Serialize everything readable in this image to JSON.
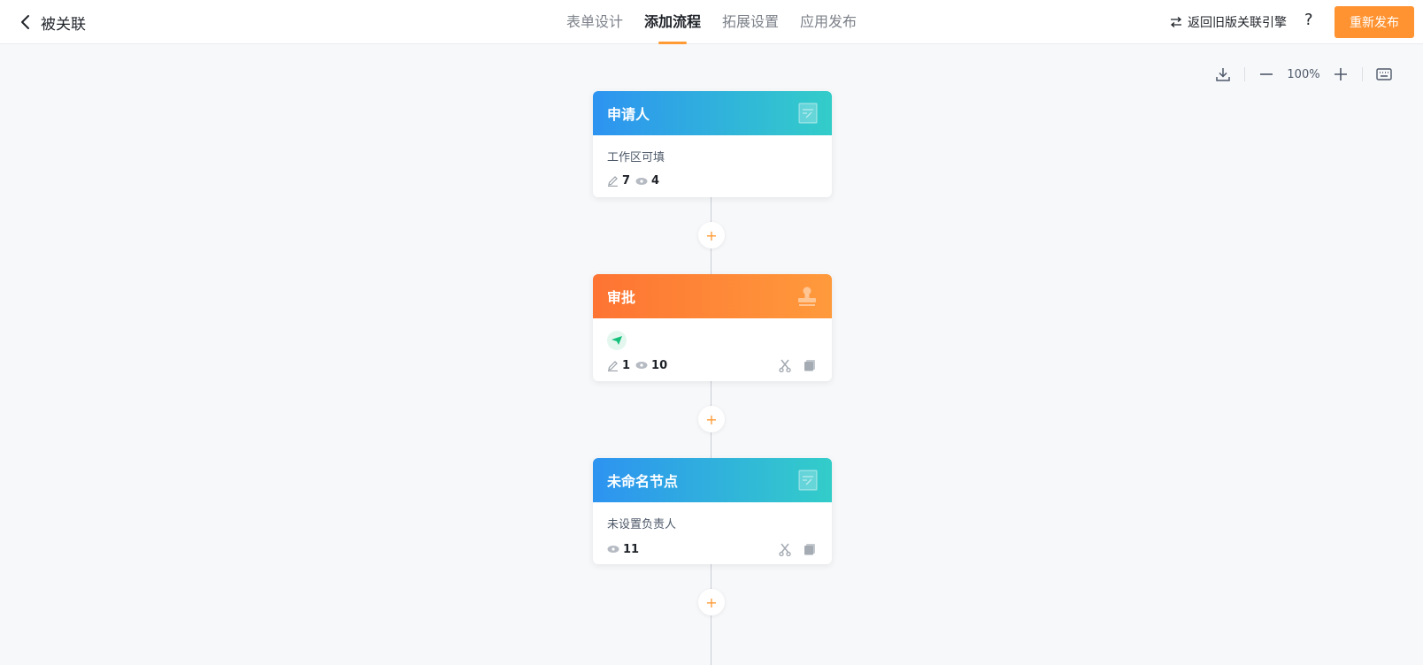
{
  "header": {
    "app_title": "被关联",
    "tabs": [
      {
        "label": "表单设计"
      },
      {
        "label": "添加流程"
      },
      {
        "label": "拓展设置"
      },
      {
        "label": "应用发布"
      }
    ],
    "active_tab": "添加流程",
    "old_engine_label": "返回旧版关联引擎",
    "help_label": "?",
    "publish_label": "重新发布"
  },
  "toolbar": {
    "zoom": "100%"
  },
  "flow": {
    "nodes": [
      {
        "title": "申请人",
        "description": "工作区可填",
        "edit_count": "7",
        "view_count": "4"
      },
      {
        "title": "审批",
        "description": "",
        "edit_count": "1",
        "view_count": "10"
      },
      {
        "title": "未命名节点",
        "description": "未设置负责人",
        "view_count": "11"
      }
    ],
    "add_symbol": "+"
  },
  "colors": {
    "accent": "#ff9331",
    "blue_gradient_start": "#2d93f1",
    "blue_gradient_end": "#33cdc9",
    "orange_gradient_start": "#fe7433",
    "orange_gradient_end": "#ff9a3c"
  }
}
